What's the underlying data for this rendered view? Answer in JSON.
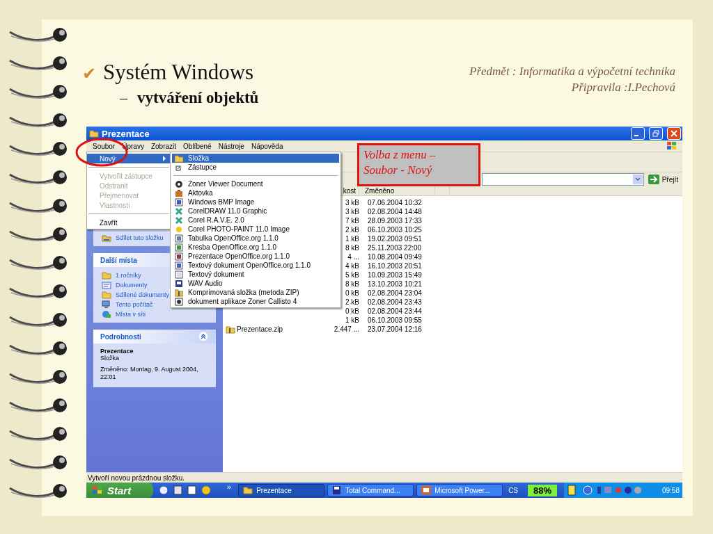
{
  "slide": {
    "bullet": "✔",
    "title": "Systém Windows",
    "sub_bullet": "–",
    "subtitle": "vytváření objektů",
    "subject": "Předmět : Informatika a výpočetní technika",
    "author": "Připravila :I.Pechová"
  },
  "window": {
    "title": "Prezentace",
    "menu": [
      "Soubor",
      "Úpravy",
      "Zobrazit",
      "Oblíbené",
      "Nástroje",
      "Nápověda"
    ],
    "file_menu": [
      [
        {
          "label": "Nový",
          "selected": true,
          "disabled": false,
          "submenu": true
        }
      ],
      [
        {
          "label": "Vytvořit zástupce",
          "selected": false,
          "disabled": true,
          "submenu": false
        },
        {
          "label": "Odstranit",
          "selected": false,
          "disabled": true,
          "submenu": false
        },
        {
          "label": "Přejmenovat",
          "selected": false,
          "disabled": true,
          "submenu": false
        },
        {
          "label": "Vlastnosti",
          "selected": false,
          "disabled": true,
          "submenu": false
        }
      ],
      [
        {
          "label": "Zavřít",
          "selected": false,
          "disabled": false,
          "submenu": false
        }
      ]
    ],
    "new_submenu": [
      [
        {
          "label": "Složka",
          "selected": true
        },
        {
          "label": "Zástupce",
          "selected": false
        }
      ],
      [
        {
          "label": "Zoner Viewer Document",
          "selected": false
        },
        {
          "label": "Aktovka",
          "selected": false
        },
        {
          "label": "Windows BMP Image",
          "selected": false
        },
        {
          "label": "CorelDRAW 11.0 Graphic",
          "selected": false
        },
        {
          "label": "Corel R.A.V.E. 2.0",
          "selected": false
        },
        {
          "label": "Corel PHOTO-PAINT 11.0 Image",
          "selected": false
        },
        {
          "label": "Tabulka OpenOffice.org 1.1.0",
          "selected": false
        },
        {
          "label": "Kresba OpenOffice.org 1.1.0",
          "selected": false
        },
        {
          "label": "Prezentace OpenOffice.org 1.1.0",
          "selected": false
        },
        {
          "label": "Textový dokument OpenOffice.org 1.1.0",
          "selected": false
        },
        {
          "label": "Textový dokument",
          "selected": false
        },
        {
          "label": "WAV Audio",
          "selected": false
        },
        {
          "label": "Komprimovaná složka (metoda ZIP)",
          "selected": false
        },
        {
          "label": "dokument aplikace Zoner Callisto 4",
          "selected": false
        }
      ]
    ],
    "address": {
      "go": "Přejít"
    },
    "task_pane": {
      "share_item": "Sdílet tuto složku",
      "places": {
        "title": "Další místa",
        "items": [
          "1.ročníky",
          "Dokumenty",
          "Sdílené dokumenty",
          "Tento počítač",
          "Místa v síti"
        ]
      },
      "details": {
        "title": "Podrobnosti",
        "expanded": true,
        "name": "Prezentace",
        "type": "Složka",
        "modified": "Změněno: Montag, 9. August 2004, 22:01"
      }
    },
    "file_list": {
      "columns": [
        "kost",
        "Změněno"
      ],
      "rows": [
        {
          "size": "3 kB",
          "modified": "07.06.2004 10:32"
        },
        {
          "size": "3 kB",
          "modified": "02.08.2004 14:48"
        },
        {
          "size": "7 kB",
          "modified": "28.09.2003 17:33"
        },
        {
          "size": "2 kB",
          "modified": "06.10.2003 10:25"
        },
        {
          "size": "1 kB",
          "modified": "19.02.2003 09:51"
        },
        {
          "size": "8 kB",
          "modified": "25.11.2003 22:00"
        },
        {
          "size": "4 ...",
          "modified": "10.08.2004 09:49"
        },
        {
          "size": "4 kB",
          "modified": "16.10.2003 20:51"
        },
        {
          "size": "5 kB",
          "modified": "10.09.2003 15:49"
        },
        {
          "size": "8 kB",
          "modified": "13.10.2003 10:21"
        },
        {
          "size": "0 kB",
          "modified": "02.08.2004 23:04"
        },
        {
          "size": "2 kB",
          "modified": "02.08.2004 23:43"
        },
        {
          "size": "0 kB",
          "modified": "02.08.2004 23:44"
        },
        {
          "size": "1 kB",
          "modified": "06.10.2003 09:55"
        },
        {
          "name": "Prezentace.zip",
          "size": "2.447 ...",
          "modified": "23.07.2004 12:16"
        }
      ]
    },
    "status_bar": "Vytvoří novou prázdnou složku.",
    "taskbar": {
      "start": "Start",
      "more": "»",
      "tasks": [
        {
          "label": "Prezentace",
          "selected": true
        },
        {
          "label": "Total Command...",
          "selected": false
        },
        {
          "label": "Microsoft Power...",
          "selected": false
        }
      ],
      "language": "CS",
      "battery": "88%",
      "clock": "09:58"
    }
  },
  "callout": {
    "lines": [
      "Volba z menu –",
      "Soubor - Nový"
    ]
  }
}
